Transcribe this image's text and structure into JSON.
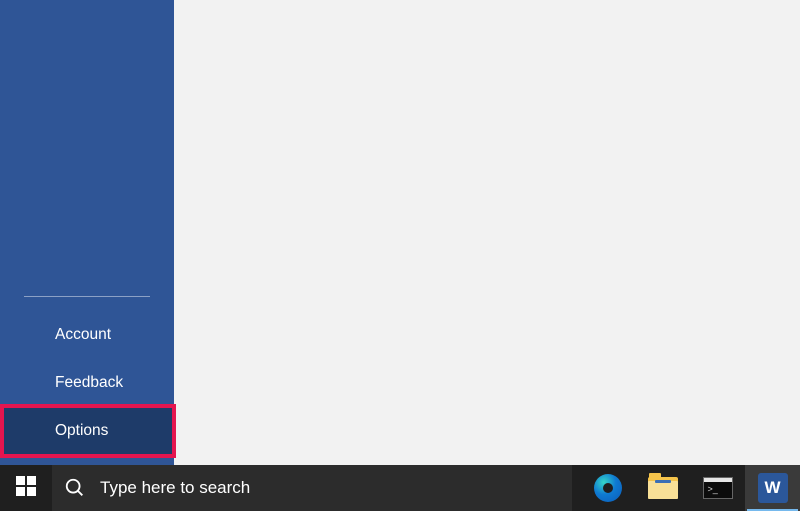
{
  "sidebar": {
    "items": [
      {
        "label": "Account"
      },
      {
        "label": "Feedback"
      },
      {
        "label": "Options"
      }
    ]
  },
  "taskbar": {
    "search_placeholder": "Type here to search"
  },
  "word_tile_letter": "W"
}
